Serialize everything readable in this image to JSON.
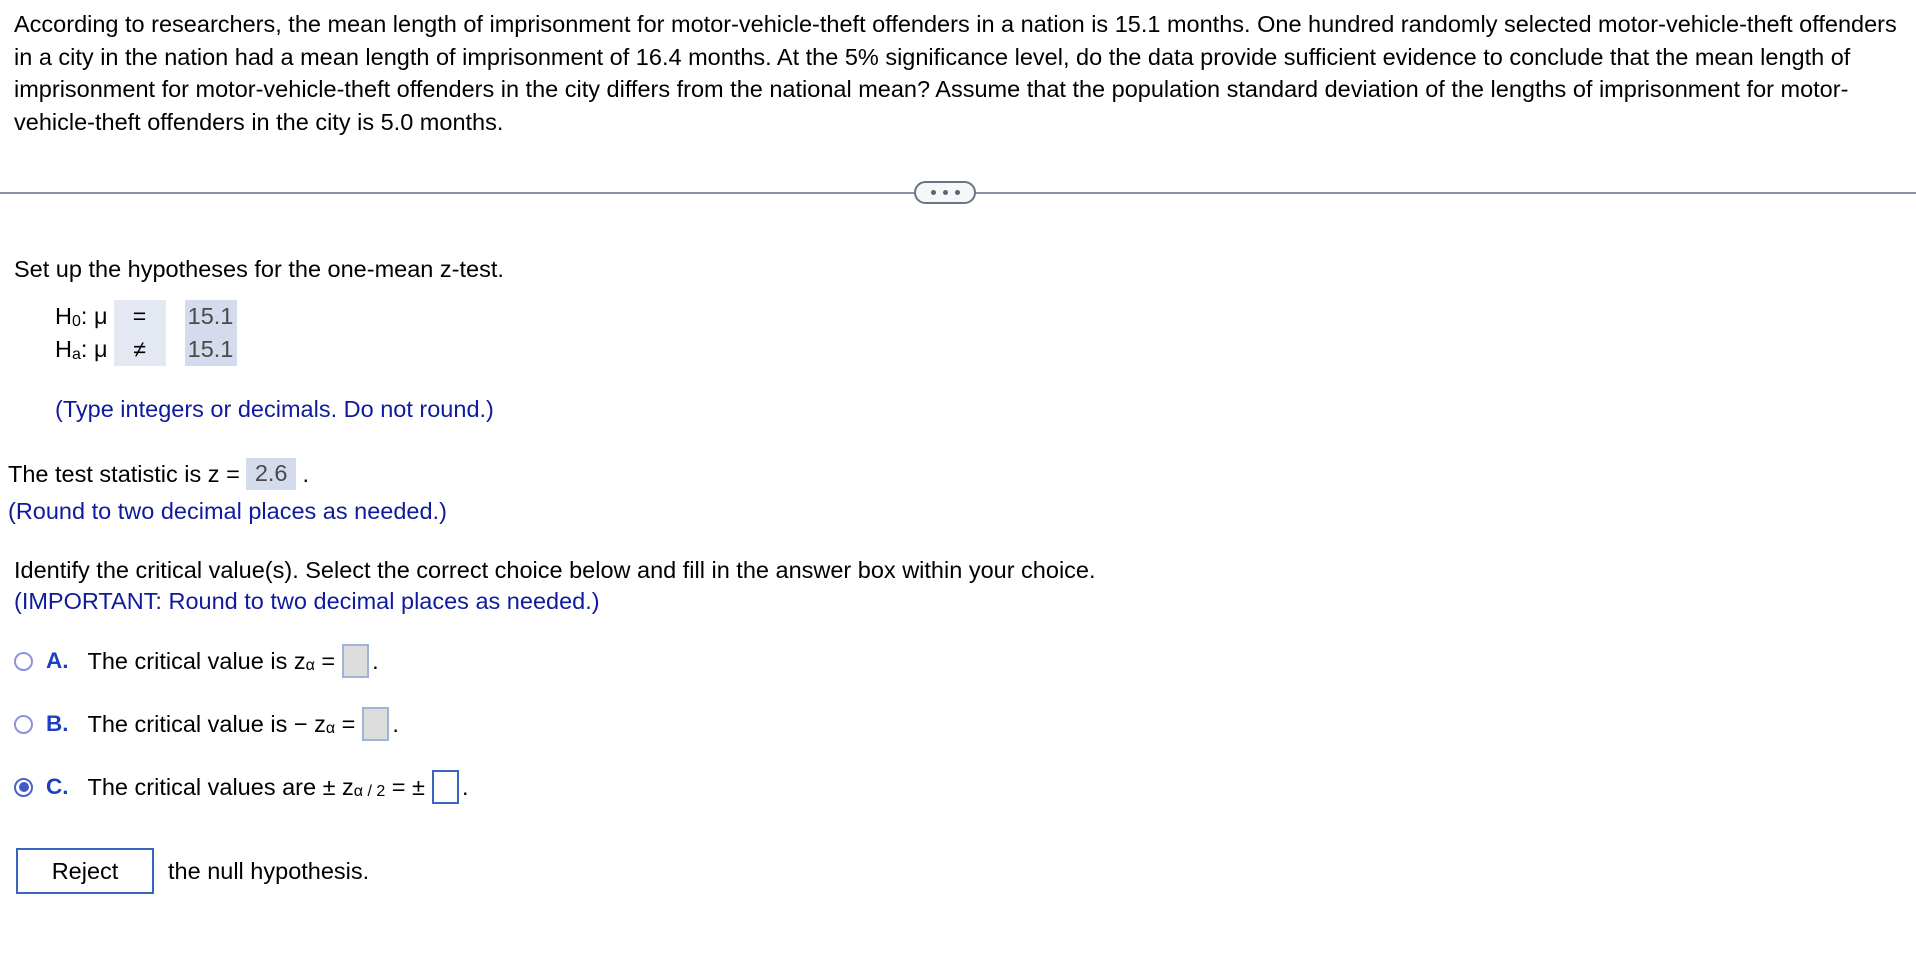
{
  "problem": {
    "statement": "According to researchers, the mean length of imprisonment for motor-vehicle-theft offenders in a nation is 15.1 months. One hundred randomly selected motor-vehicle-theft offenders in a city in the nation had a mean length of imprisonment of 16.4 months. At the 5% significance level, do the data provide sufficient evidence to conclude that the mean length of imprisonment for motor-vehicle-theft offenders in the city differs from the national mean? Assume that the population standard deviation of the lengths of imprisonment for motor-vehicle-theft offenders in the city is 5.0 months."
  },
  "divider": {
    "ellipsis_label": "..."
  },
  "hypotheses": {
    "prompt": "Set up the hypotheses for the one-mean z-test.",
    "null": {
      "label_h": "H",
      "label_sub": "0",
      "label_mu": ": μ",
      "operator": "=",
      "value": "15.1"
    },
    "alt": {
      "label_h": "H",
      "label_sub": "a",
      "label_mu": ": μ",
      "operator": "≠",
      "value": "15.1"
    },
    "note": "(Type integers or decimals. Do not round.)"
  },
  "test_statistic": {
    "prefix": "The test statistic is z =",
    "value": "2.6",
    "suffix": ".",
    "note": "(Round to two decimal places as needed.)"
  },
  "critical_value": {
    "prompt": "Identify the critical value(s). Select the correct choice below and fill in the answer box within your choice.",
    "note": "(IMPORTANT: Round to two decimal places as needed.)",
    "choices": [
      {
        "letter": "A.",
        "text_before": "The critical value is z",
        "subscript": "α",
        "equals": "=",
        "answer": "",
        "text_after": ".",
        "selected": false
      },
      {
        "letter": "B.",
        "text_before": "The critical value is − z",
        "subscript": "α",
        "equals": "=",
        "answer": "",
        "text_after": ".",
        "selected": false
      },
      {
        "letter": "C.",
        "text_before": "The critical values are ± z",
        "subscript": "α / 2",
        "equals": "= ±",
        "answer": "",
        "text_after": ".",
        "selected": true
      }
    ]
  },
  "conclusion": {
    "selected_option": "Reject",
    "text_after": "the null hypothesis."
  },
  "colors": {
    "link_blue": "#0f1b9c",
    "choice_blue": "#1f3fbf",
    "active_border": "#3b63c0",
    "filled_field": "#d3dbec",
    "operator_field": "#e3e8f2",
    "divider_gray": "#8b94a6"
  }
}
